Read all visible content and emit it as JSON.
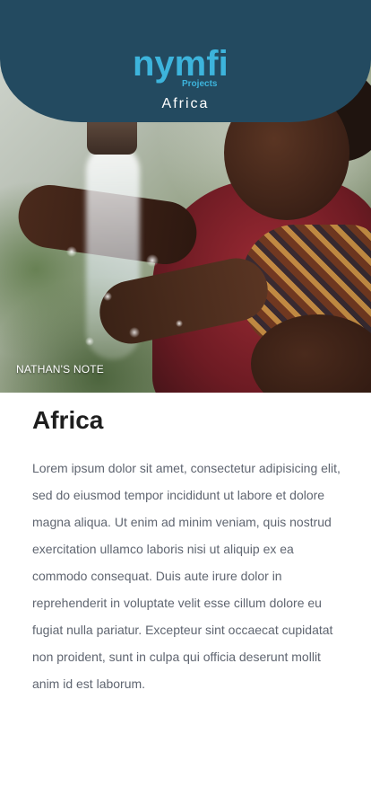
{
  "header": {
    "logo_text": "nymfi",
    "logo_subtext": "Projects",
    "title": "Africa"
  },
  "hero": {
    "note_label": "NATHAN'S NOTE"
  },
  "article": {
    "title": "Africa",
    "body": "Lorem ipsum dolor sit amet, consectetur adipisicing elit, sed do eiusmod tempor incididunt ut labore et dolore magna aliqua. Ut enim ad minim veniam, quis nostrud exercitation ullamco laboris nisi ut aliquip ex ea commodo consequat. Duis aute irure dolor in reprehenderit in voluptate velit esse cillum dolore eu fugiat nulla pariatur. Excepteur sint occaecat cupidatat non proident, sunt in culpa qui officia deserunt mollit anim id est laborum."
  },
  "colors": {
    "header_bg": "#234a60",
    "logo_accent": "#3db4dc",
    "title_text": "#1e1e1e",
    "body_text": "#5f6570"
  }
}
